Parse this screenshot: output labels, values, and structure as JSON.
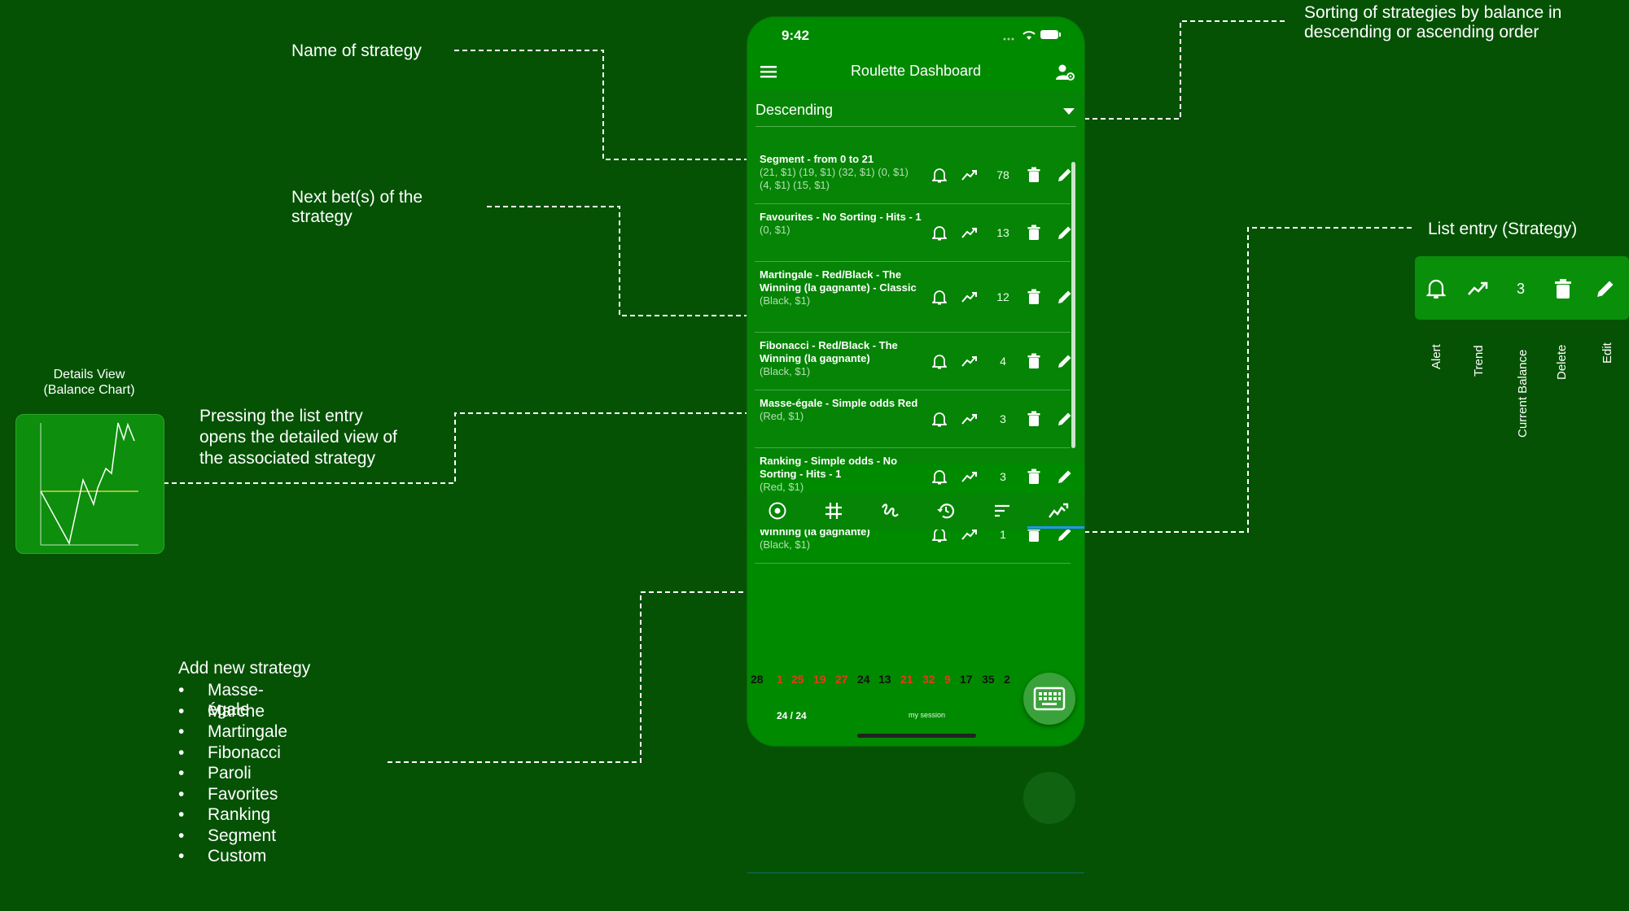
{
  "annotations": {
    "name_of_strategy": "Name of strategy",
    "next_bets_line1": "Next bet(s) of the",
    "next_bets_line2": "strategy",
    "details_view_line1": "Details View",
    "details_view_line2": "(Balance Chart)",
    "pressing_line1": "Pressing the list entry",
    "pressing_line2": "opens the detailed view of",
    "pressing_line3": "the associated strategy",
    "add_new_strategy": "Add new strategy",
    "strategy_types": [
      "Masse-égale",
      "Marche",
      "Martingale",
      "Fibonacci",
      "Paroli",
      "Favorites",
      "Ranking",
      "Segment",
      "Custom"
    ],
    "sorting_line1": "Sorting of strategies by balance in",
    "sorting_line2": "descending or ascending order",
    "list_entry_title": "List entry (Strategy)",
    "legend_sample_balance": "3",
    "legend_labels": [
      "Alert",
      "Trend",
      "Current Balance",
      "Delete",
      "Edit"
    ]
  },
  "phone": {
    "time": "9:42",
    "title": "Roulette Dashboard",
    "sort_value": "Descending",
    "strategies": [
      {
        "name": "Segment - from 0 to 21",
        "bets": "(21, $1) (19, $1) (32, $1) (0, $1) (4, $1) (15, $1)",
        "balance": "78"
      },
      {
        "name": "Favourites - No Sorting - Hits - 1",
        "bets": "(0, $1)",
        "balance": "13"
      },
      {
        "name": "Martingale - Red/Black - The Winning (la gagnante) - Classic",
        "bets": "(Black, $1)",
        "balance": "12"
      },
      {
        "name": "Fibonacci - Red/Black - The Winning (la gagnante)",
        "bets": "(Black, $1)",
        "balance": "4"
      },
      {
        "name": "Masse-égale - Simple odds Red",
        "bets": "(Red, $1)",
        "balance": "3"
      },
      {
        "name": "Ranking - Simple odds - No Sorting - Hits - 1",
        "bets": "(Red, $1)",
        "balance": "3"
      },
      {
        "name": "Marche - Red/Black - The Winning (la gagnante)",
        "bets": "(Black, $1)",
        "balance": "1"
      }
    ],
    "recent_numbers": [
      {
        "n": "28",
        "color": "black"
      },
      {
        "n": "1",
        "color": "red"
      },
      {
        "n": "25",
        "color": "red"
      },
      {
        "n": "19",
        "color": "red"
      },
      {
        "n": "27",
        "color": "red"
      },
      {
        "n": "24",
        "color": "black"
      },
      {
        "n": "13",
        "color": "black"
      },
      {
        "n": "21",
        "color": "red"
      },
      {
        "n": "32",
        "color": "red"
      },
      {
        "n": "9",
        "color": "red"
      },
      {
        "n": "17",
        "color": "black"
      },
      {
        "n": "35",
        "color": "black"
      },
      {
        "n": "2",
        "color": "black"
      }
    ],
    "count": "24 / 24",
    "session": "my session",
    "nav_icons": [
      "roulette-wheel-icon",
      "grid-icon",
      "draw-icon",
      "history-icon",
      "sort-icon",
      "trend-chart-icon"
    ],
    "active_nav": 5
  },
  "colors": {
    "background": "#055205",
    "phone": "#008a00",
    "red_number": "#e53a1a",
    "black_number": "#111111",
    "accent_tab": "#2196f3"
  }
}
